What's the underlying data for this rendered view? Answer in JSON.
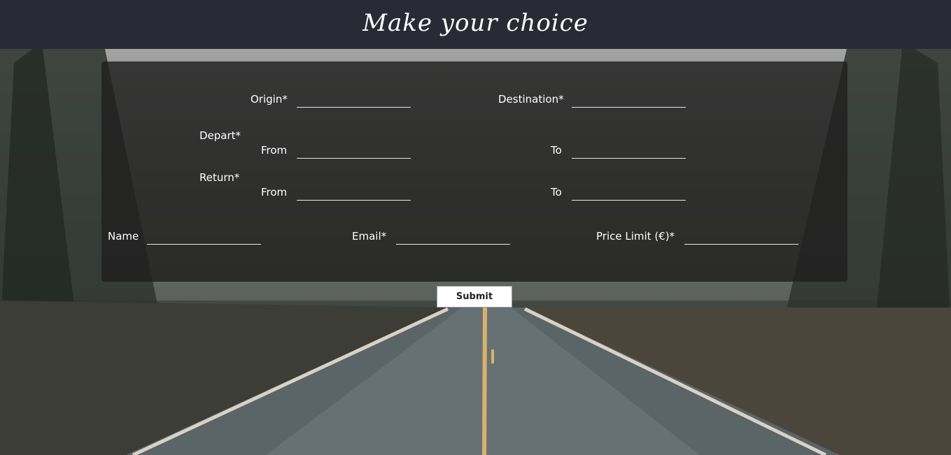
{
  "header": {
    "title": "Make your choice"
  },
  "form": {
    "origin": {
      "label": "Origin*",
      "value": ""
    },
    "destination": {
      "label": "Destination*",
      "value": ""
    },
    "depart": {
      "label": "Depart*",
      "from_label": "From",
      "from_value": "",
      "to_label": "To",
      "to_value": ""
    },
    "return": {
      "label": "Return*",
      "from_label": "From",
      "from_value": "",
      "to_label": "To",
      "to_value": ""
    },
    "name": {
      "label": "Name",
      "value": ""
    },
    "email": {
      "label": "Email*",
      "value": ""
    },
    "price_limit": {
      "label": "Price Limit (€)*",
      "value": ""
    },
    "submit_label": "Submit"
  },
  "background": {
    "scene": "rainy-forest-road-photo"
  },
  "colors": {
    "header_bg": "#282b35",
    "panel_bg": "#201e1e",
    "text": "#ffffff"
  }
}
